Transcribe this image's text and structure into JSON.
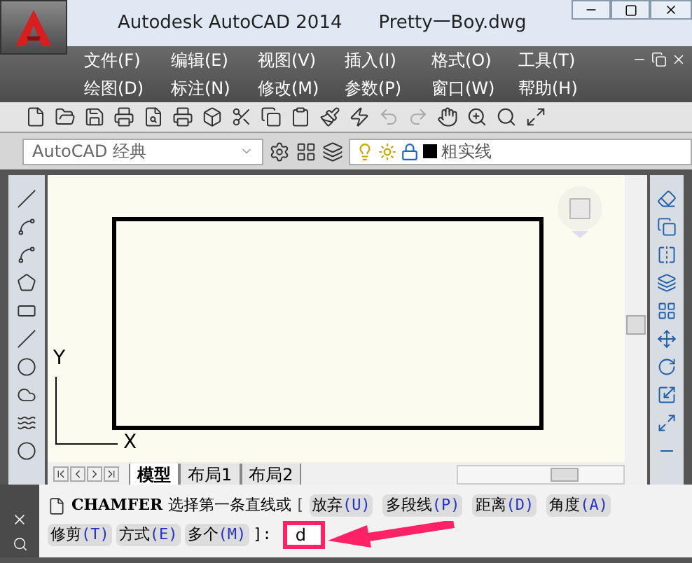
{
  "app": {
    "title": "Autodesk AutoCAD 2014",
    "file": "Pretty一Boy.dwg"
  },
  "menu_rows": [
    {
      "items": [
        "文件(F)",
        "编辑(E)",
        "视图(V)",
        "插入(I)",
        "格式(O)",
        "工具(T)"
      ]
    },
    {
      "items": [
        "绘图(D)",
        "标注(N)",
        "修改(M)",
        "参数(P)",
        "窗口(W)",
        "帮助(H)"
      ]
    }
  ],
  "workspace": {
    "value": "AutoCAD 经典"
  },
  "layer": {
    "value": "粗实线"
  },
  "ucs": {
    "y": "Y",
    "x": "X"
  },
  "layout_tabs": [
    {
      "label": "模型",
      "selected": true
    },
    {
      "label": "布局1",
      "selected": false
    },
    {
      "label": "布局2",
      "selected": false
    }
  ],
  "command": {
    "name": "CHAMFER",
    "prompt": "选择第一条直线或",
    "open": "[",
    "options": [
      {
        "label": "放弃",
        "key": "(U)"
      },
      {
        "label": "多段线",
        "key": "(P)"
      },
      {
        "label": "距离",
        "key": "(D)"
      },
      {
        "label": "角度",
        "key": "(A)"
      },
      {
        "label": "修剪",
        "key": "(T)"
      },
      {
        "label": "方式",
        "key": "(E)"
      },
      {
        "label": "多个",
        "key": "(M)"
      }
    ],
    "close": "]:",
    "input": "d"
  }
}
